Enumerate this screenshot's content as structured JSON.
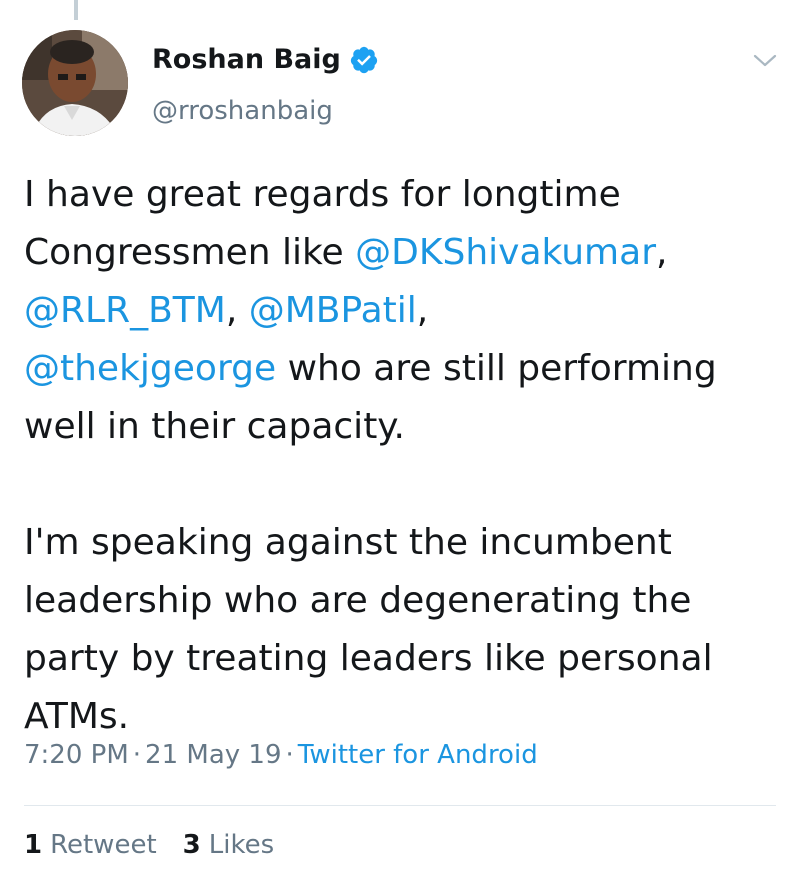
{
  "author": {
    "name": "Roshan Baig",
    "handle": "@rroshanbaig",
    "verified": true
  },
  "icons": {
    "verified": "verified-badge-icon",
    "menu": "chevron-down-icon"
  },
  "colors": {
    "link": "#1b95e0",
    "text": "#14171a",
    "muted": "#657786"
  },
  "tweet": {
    "p1_part1": "I have great regards for longtime Congressmen like ",
    "mention1": "@DKShivakumar",
    "sep1": ", ",
    "mention2": "@RLR_BTM",
    "sep2": ", ",
    "mention3": "@MBPatil",
    "sep3": ", ",
    "mention4": "@thekjgeorge",
    "p1_part2": " who are still performing well in their capacity.",
    "p2": "I'm speaking against the incumbent leadership who are degenerating the party by treating leaders like personal ATMs."
  },
  "meta": {
    "time": "7:20 PM",
    "separator": "·",
    "date": "21 May 19",
    "source": "Twitter for Android"
  },
  "stats": {
    "retweets_count": "1",
    "retweets_label": "Retweet",
    "likes_count": "3",
    "likes_label": "Likes"
  }
}
